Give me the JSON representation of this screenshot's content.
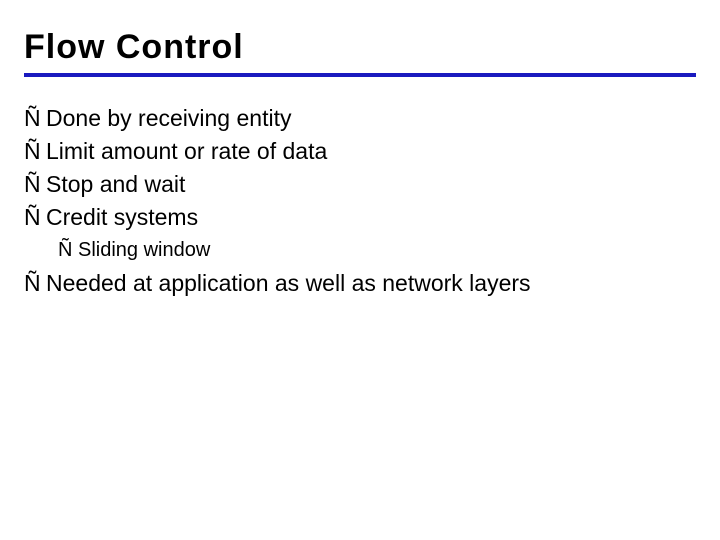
{
  "title": "Flow Control",
  "bullet_glyph": "Ñ",
  "items": [
    {
      "text": "Done by receiving entity"
    },
    {
      "text": "Limit amount or rate of data"
    },
    {
      "text": "Stop and wait"
    },
    {
      "text": "Credit systems"
    }
  ],
  "sub_item": {
    "text": "Sliding window"
  },
  "last_item": {
    "text": "Needed at application as well as network layers"
  },
  "colors": {
    "rule": "#1a1abf"
  }
}
